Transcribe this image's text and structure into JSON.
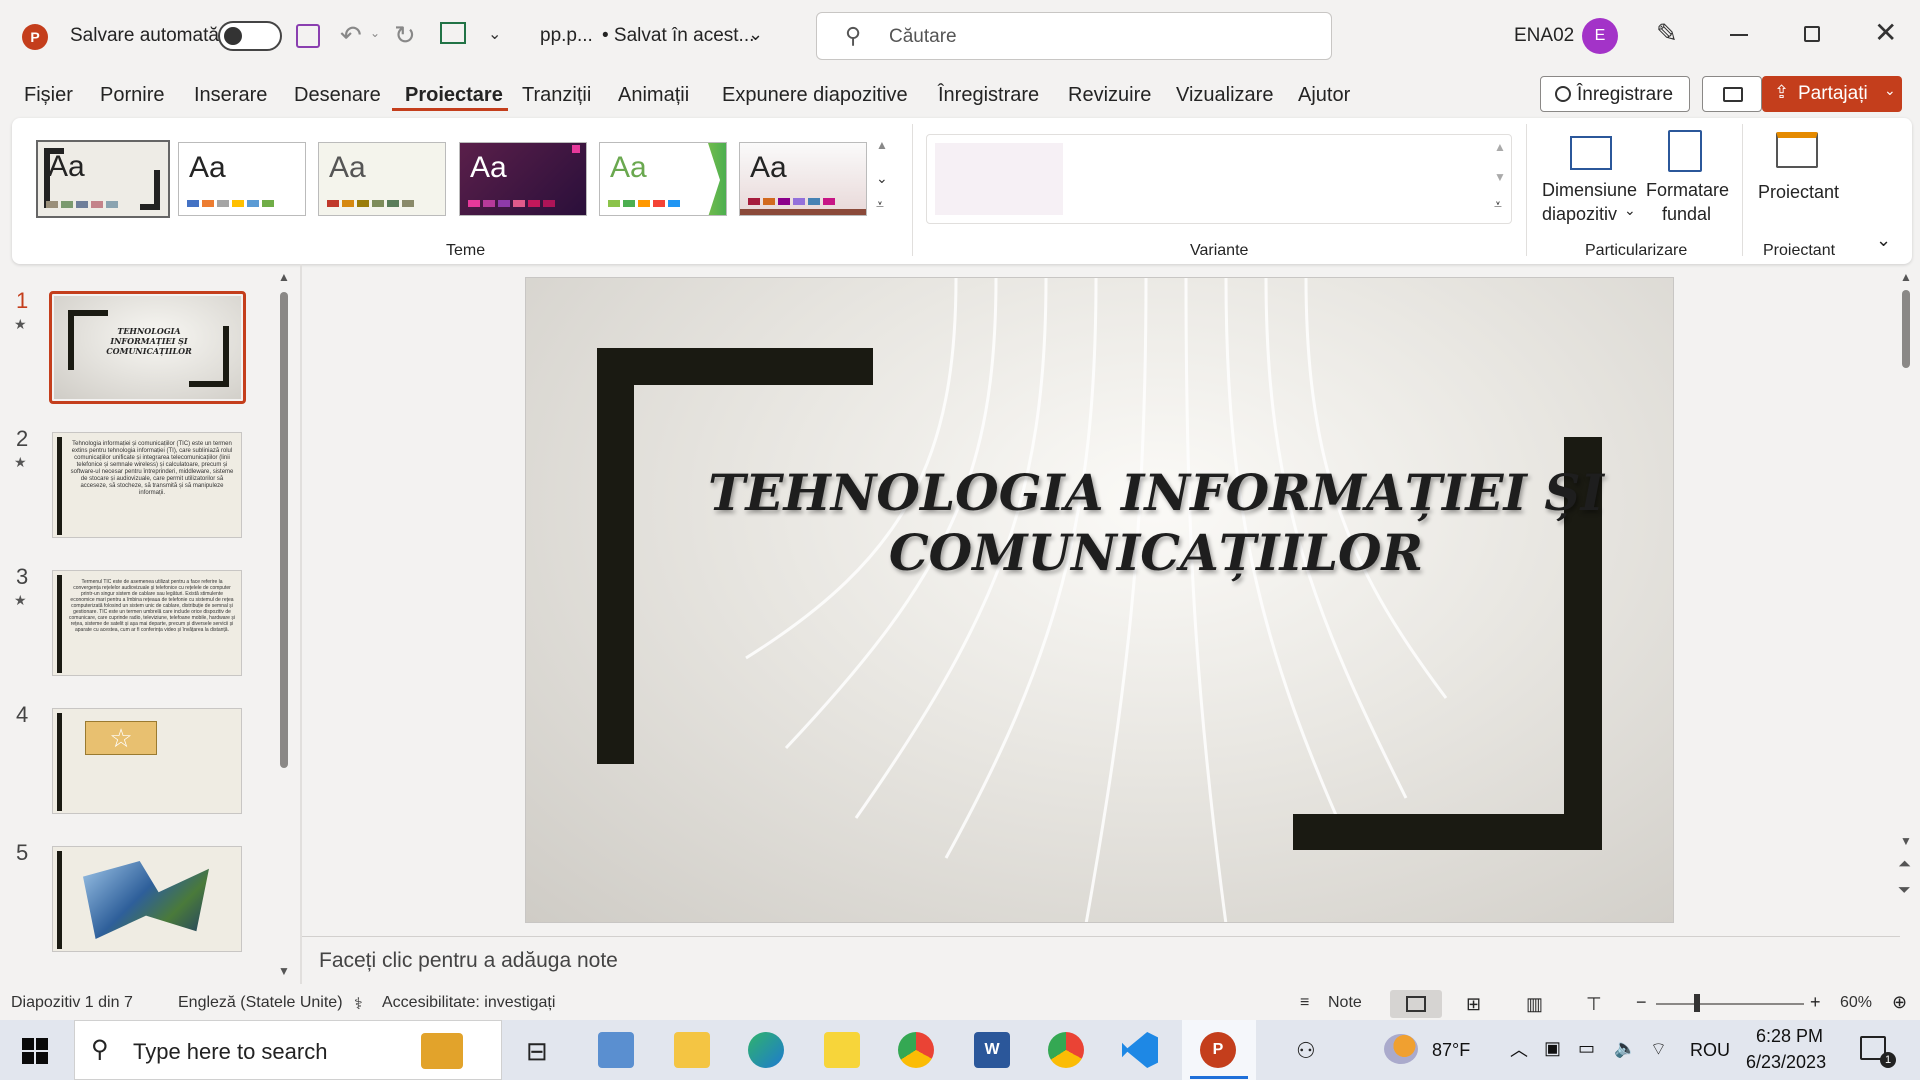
{
  "titlebar": {
    "autosave_label": "Salvare automată",
    "filename": "pp.p...",
    "saved_status": "• Salvat în acest...",
    "search_placeholder": "Căutare",
    "user_name": "ENA02",
    "avatar_initial": "E"
  },
  "menu": {
    "tabs": [
      "Fișier",
      "Pornire",
      "Inserare",
      "Desenare",
      "Proiectare",
      "Tranziții",
      "Animații",
      "Expunere diapozitive",
      "Înregistrare",
      "Revizuire",
      "Vizualizare",
      "Ajutor"
    ],
    "active_tab": "Proiectare",
    "record_button": "Înregistrare",
    "share_button": "Partajați"
  },
  "ribbon": {
    "themes_label": "Teme",
    "variants_label": "Variante",
    "customize_label": "Particularizare",
    "designer_group_label": "Proiectant",
    "slide_size_line1": "Dimensiune",
    "slide_size_line2": "diapozitiv",
    "format_bg_line1": "Formatare",
    "format_bg_line2": "fundal",
    "designer_button": "Proiectant",
    "theme_glyph": "Aa"
  },
  "slides": {
    "numbers": [
      "1",
      "2",
      "3",
      "4",
      "5"
    ],
    "thumb1_title": "TEHNOLOGIA INFORMAȚIEI ȘI COMUNICAȚIILOR",
    "thumb2_text": "Tehnologia informației și comunicațiilor (TIC) este un termen extins pentru tehnologia informației (TI), care subliniază rolul comunicațiilor unificate și integrarea telecomunicațiilor (linii telefonice și semnale wireless) și calculatoare, precum și software-ul necesar pentru întreprinderi, middleware, sisteme de stocare și audiovizuale, care permit utilizatorilor să acceseze, să stocheze, să transmită și să manipuleze informații.",
    "thumb3_text": "Termenul TIC este de asemenea utilizat pentru a face referire la convergența rețelelor audiovizuale și telefonice cu rețelele de computer printr-un singur sistem de cablare sau legături. Există stimulente economice mari pentru a îmbina rețeaua de telefonie cu sistemul de rețea computerizată folosind un sistem unic de cablare, distribuție de semnal și gestionare. TIC este un termen umbrelă care include orice dispozitiv de comunicare, care cuprinde radio, televiziune, telefoane mobile, hardware și rețea, sisteme de satelit și așa mai departe, precum și diversele servicii și aparate cu acestea, cum ar fi conferința video și învățarea la distanță."
  },
  "slide": {
    "title": "TEHNOLOGIA INFORMAȚIEI ȘI COMUNICAȚIILOR"
  },
  "notes_placeholder": "Faceți clic pentru a adăuga note",
  "status": {
    "slide_counter": "Diapozitiv 1 din 7",
    "language": "Engleză (Statele Unite)",
    "accessibility": "Accesibilitate: investigați",
    "notes_button": "Note",
    "zoom": "60%"
  },
  "taskbar": {
    "search_placeholder": "Type here to search",
    "weather": "87°F",
    "lang": "ROU",
    "time": "6:28 PM",
    "date": "6/23/2023",
    "notification_count": "1"
  },
  "colors": {
    "accent": "#c43e1c",
    "slide_frame": "#1a1a12"
  }
}
